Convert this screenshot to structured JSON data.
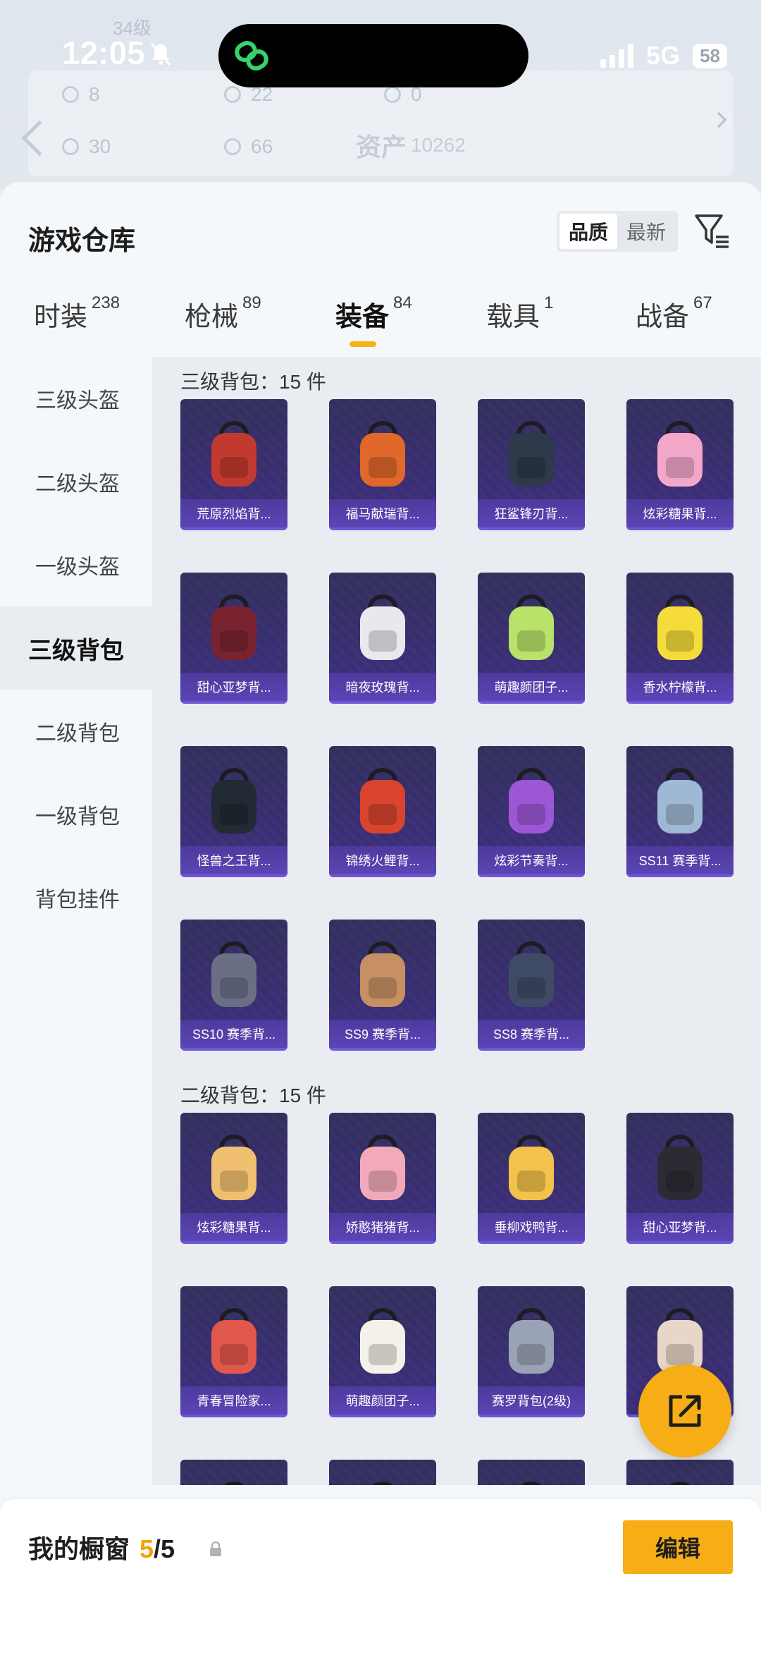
{
  "status_bar": {
    "time": "12:05",
    "network": "5G",
    "battery": "58"
  },
  "background": {
    "level": "34级",
    "stats": [
      "8",
      "22",
      "0",
      "30",
      "66"
    ],
    "asset_label": "资产",
    "asset_value": "10262"
  },
  "header": {
    "title": "游戏仓库",
    "sort": {
      "quality": "品质",
      "latest": "最新"
    }
  },
  "tabs": [
    {
      "label": "时装",
      "count": "238"
    },
    {
      "label": "枪械",
      "count": "89"
    },
    {
      "label": "装备",
      "count": "84"
    },
    {
      "label": "载具",
      "count": "1"
    },
    {
      "label": "战备",
      "count": "67"
    }
  ],
  "sidebar": [
    {
      "label": "三级头盔"
    },
    {
      "label": "二级头盔"
    },
    {
      "label": "一级头盔"
    },
    {
      "label": "三级背包"
    },
    {
      "label": "二级背包"
    },
    {
      "label": "一级背包"
    },
    {
      "label": "背包挂件"
    }
  ],
  "sections": [
    {
      "title": "三级背包：15 件",
      "items": [
        {
          "name": "荒原烈焰背...",
          "color": "#c23a2f"
        },
        {
          "name": "福马献瑞背...",
          "color": "#e0682a"
        },
        {
          "name": "狂鲨锋刃背...",
          "color": "#2d3a4a"
        },
        {
          "name": "炫彩糖果背...",
          "color": "#f2a6c8"
        },
        {
          "name": "甜心亚梦背...",
          "color": "#7a2330"
        },
        {
          "name": "暗夜玫瑰背...",
          "color": "#e8e8ee"
        },
        {
          "name": "萌趣颜团子...",
          "color": "#b9e26a"
        },
        {
          "name": "香水柠檬背...",
          "color": "#f6dc3b"
        },
        {
          "name": "怪兽之王背...",
          "color": "#222a33"
        },
        {
          "name": "锦绣火鲤背...",
          "color": "#d8442e"
        },
        {
          "name": "炫彩节奏背...",
          "color": "#9b57d6"
        },
        {
          "name": "SS11 赛季背...",
          "color": "#9fb8d4"
        },
        {
          "name": "SS10 赛季背...",
          "color": "#6a6f86"
        },
        {
          "name": "SS9 赛季背...",
          "color": "#c69062"
        },
        {
          "name": "SS8 赛季背...",
          "color": "#3f4b66"
        }
      ]
    },
    {
      "title": "二级背包：15 件",
      "items": [
        {
          "name": "炫彩糖果背...",
          "color": "#f0c070"
        },
        {
          "name": "娇憨猪猪背...",
          "color": "#f2a9b9"
        },
        {
          "name": "垂柳戏鸭背...",
          "color": "#f2c24a"
        },
        {
          "name": "甜心亚梦背...",
          "color": "#2b2b33"
        },
        {
          "name": "青春冒险家...",
          "color": "#e2574c"
        },
        {
          "name": "萌趣颜团子...",
          "color": "#f4f1ea"
        },
        {
          "name": "赛罗背包(2级)",
          "color": "#9aa3b5"
        },
        {
          "name": "",
          "color": "#e8d6c8"
        },
        {
          "name": "",
          "color": "#4a3f8a"
        },
        {
          "name": "",
          "color": "#4a3f8a"
        },
        {
          "name": "",
          "color": "#4a3f8a"
        },
        {
          "name": "",
          "color": "#4a3f8a"
        }
      ]
    }
  ],
  "bottom": {
    "title": "我的橱窗",
    "count": "5",
    "total": "/5",
    "edit": "编辑"
  },
  "colors": {
    "accent": "#f7ad16",
    "card_bg": "#3a2f7a"
  }
}
